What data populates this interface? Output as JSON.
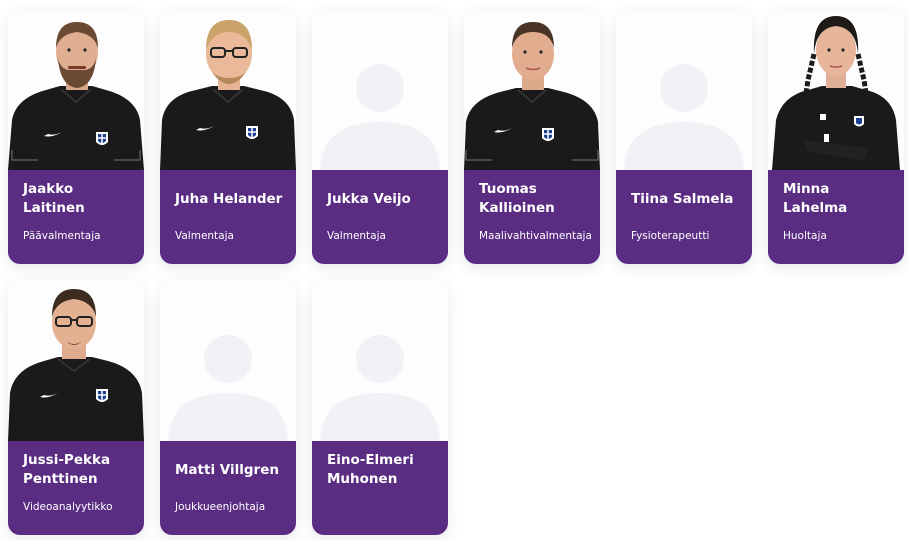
{
  "colors": {
    "panel": "#5a2d82",
    "placeholder": "#f1f2f5",
    "shirt": "#1a1a1c",
    "crest_blue": "#1b3f91"
  },
  "staff": [
    {
      "first": "Jaakko",
      "last": "Laitinen",
      "role": "Päävalmentaja",
      "photo": "beard-icon"
    },
    {
      "first": "Juha Helander",
      "last": "",
      "role": "Valmentaja",
      "photo": "glasses-icon"
    },
    {
      "first": "Jukka Veijo",
      "last": "",
      "role": "Valmentaja",
      "photo": "placeholder-avatar-icon"
    },
    {
      "first": "Tuomas",
      "last": "Kallioinen",
      "role": "Maalivahtivalmentaja",
      "photo": "person-icon"
    },
    {
      "first": "Tiina Salmela",
      "last": "",
      "role": "Fysioterapeutti",
      "photo": "placeholder-avatar-icon"
    },
    {
      "first": "Minna",
      "last": "Lahelma",
      "role": "Huoltaja",
      "photo": "braids-icon"
    },
    {
      "first": "Jussi-Pekka",
      "last": "Penttinen",
      "role": "Videoanalyytikko",
      "photo": "glasses-icon"
    },
    {
      "first": "Matti Villgren",
      "last": "",
      "role": "Joukkueenjohtaja",
      "photo": "placeholder-avatar-icon"
    },
    {
      "first": "Eino-Elmeri",
      "last": "Muhonen",
      "role": "",
      "photo": "placeholder-avatar-icon"
    }
  ]
}
